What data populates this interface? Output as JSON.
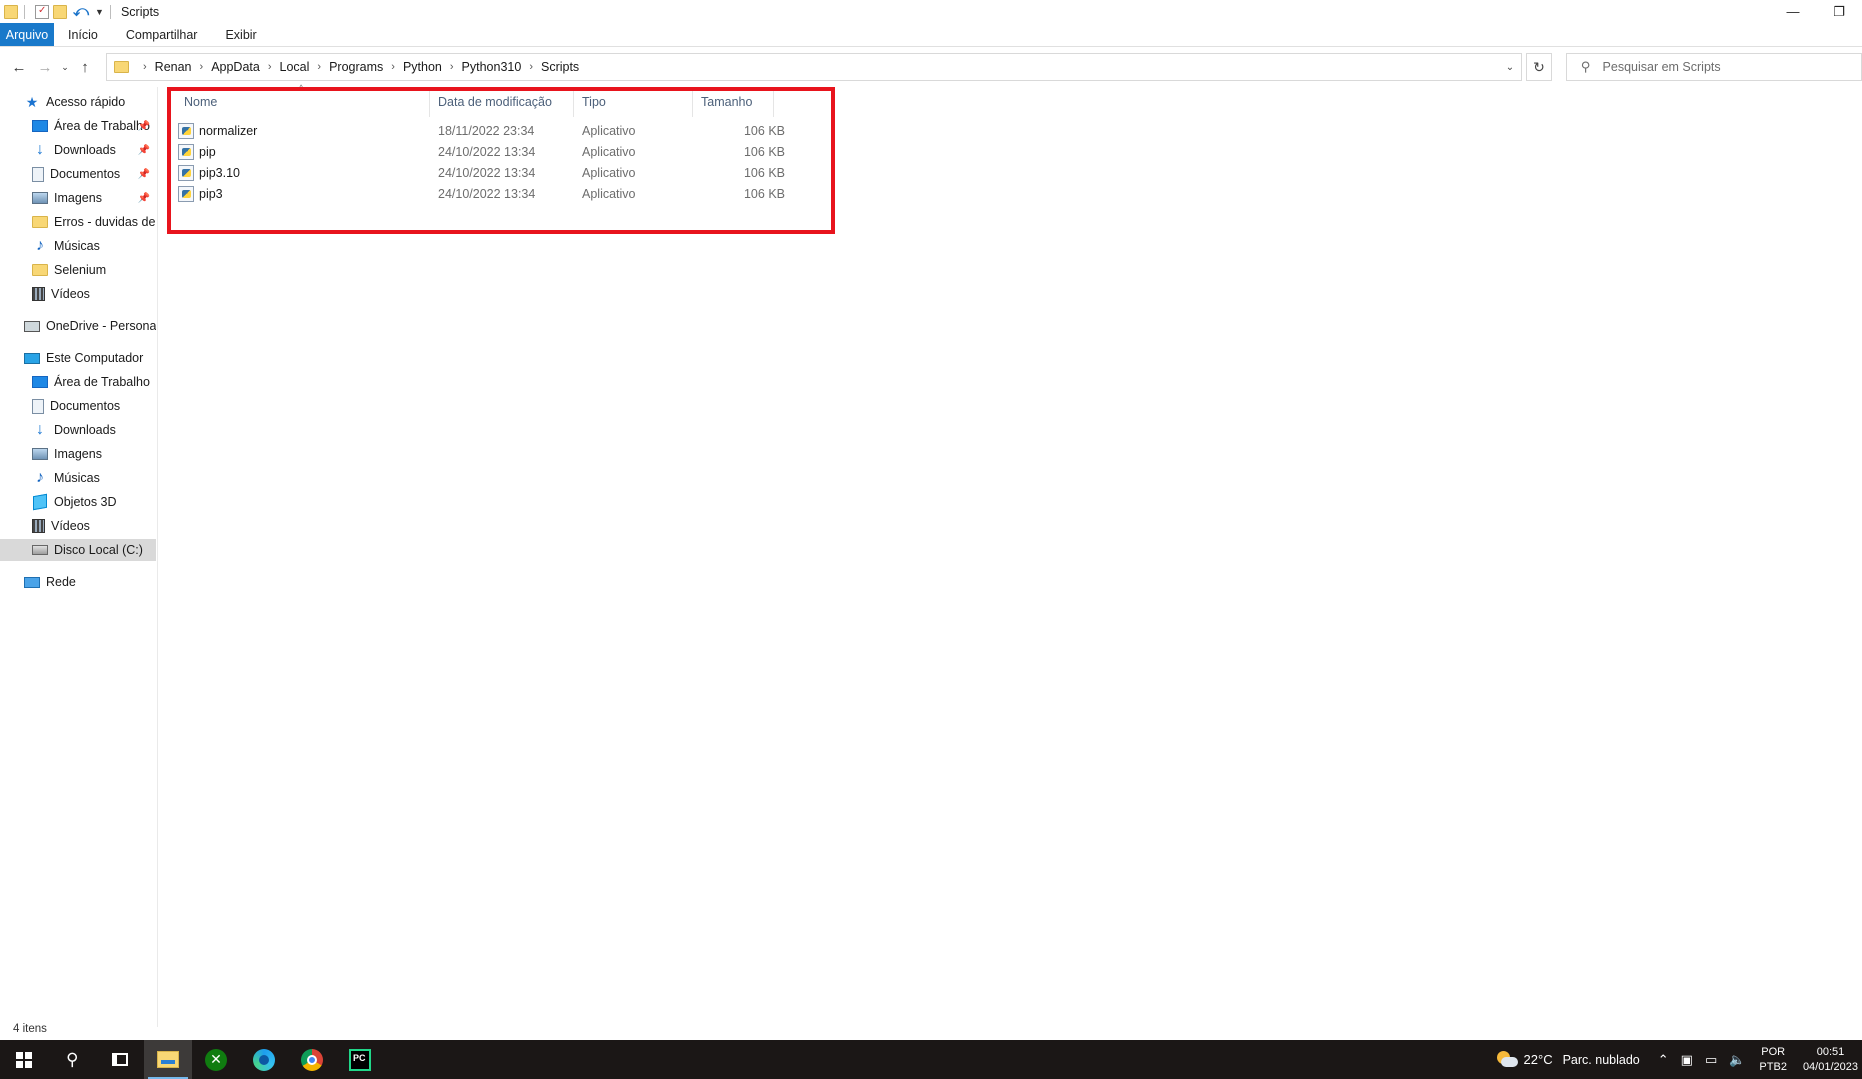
{
  "window": {
    "title": "Scripts",
    "minimize_label": "—",
    "restore_label": "❐"
  },
  "ribbon": {
    "tabs": [
      "Arquivo",
      "Início",
      "Compartilhar",
      "Exibir"
    ]
  },
  "nav": {
    "back": "←",
    "forward": "→",
    "recent": "⌄",
    "up": "↑"
  },
  "address": {
    "crumbs": [
      "Renan",
      "AppData",
      "Local",
      "Programs",
      "Python",
      "Python310",
      "Scripts"
    ],
    "dropdown": "⌄",
    "refresh": "↻"
  },
  "search": {
    "placeholder": "Pesquisar em Scripts"
  },
  "sidebar": {
    "quick_access": {
      "label": "Acesso rápido",
      "items": [
        {
          "label": "Área de Trabalho",
          "icon": "desktop-icon",
          "pinned": true
        },
        {
          "label": "Downloads",
          "icon": "download-icon",
          "pinned": true
        },
        {
          "label": "Documentos",
          "icon": "document-icon",
          "pinned": true
        },
        {
          "label": "Imagens",
          "icon": "image-icon",
          "pinned": true
        },
        {
          "label": "Erros - duvidas de p",
          "icon": "folder-icon",
          "pinned": false
        },
        {
          "label": "Músicas",
          "icon": "music-icon",
          "pinned": false
        },
        {
          "label": "Selenium",
          "icon": "folder-icon",
          "pinned": false
        },
        {
          "label": "Vídeos",
          "icon": "video-icon",
          "pinned": false
        }
      ]
    },
    "onedrive": {
      "label": "OneDrive - Personal"
    },
    "this_pc": {
      "label": "Este Computador",
      "items": [
        {
          "label": "Área de Trabalho",
          "icon": "desktop-icon"
        },
        {
          "label": "Documentos",
          "icon": "document-icon"
        },
        {
          "label": "Downloads",
          "icon": "download-icon"
        },
        {
          "label": "Imagens",
          "icon": "image-icon"
        },
        {
          "label": "Músicas",
          "icon": "music-icon"
        },
        {
          "label": "Objetos 3D",
          "icon": "objects-3d-icon"
        },
        {
          "label": "Vídeos",
          "icon": "video-icon"
        },
        {
          "label": "Disco Local (C:)",
          "icon": "disk-icon",
          "selected": true
        }
      ]
    },
    "network": {
      "label": "Rede"
    }
  },
  "file_list": {
    "columns": [
      "Nome",
      "Data de modificação",
      "Tipo",
      "Tamanho"
    ],
    "rows": [
      {
        "name": "normalizer",
        "modified": "18/11/2022 23:34",
        "type": "Aplicativo",
        "size": "106 KB"
      },
      {
        "name": "pip",
        "modified": "24/10/2022 13:34",
        "type": "Aplicativo",
        "size": "106 KB"
      },
      {
        "name": "pip3.10",
        "modified": "24/10/2022 13:34",
        "type": "Aplicativo",
        "size": "106 KB"
      },
      {
        "name": "pip3",
        "modified": "24/10/2022 13:34",
        "type": "Aplicativo",
        "size": "106 KB"
      }
    ]
  },
  "status": {
    "item_count": "4 itens"
  },
  "taskbar": {
    "weather_temp": "22°C",
    "weather_desc": "Parc. nublado",
    "lang_top": "POR",
    "lang_bottom": "PTB2",
    "time": "00:51",
    "date": "04/01/2023"
  },
  "colors": {
    "accent": "#1979ca",
    "highlight_box": "#e8141d",
    "taskbar": "#1b1716"
  }
}
